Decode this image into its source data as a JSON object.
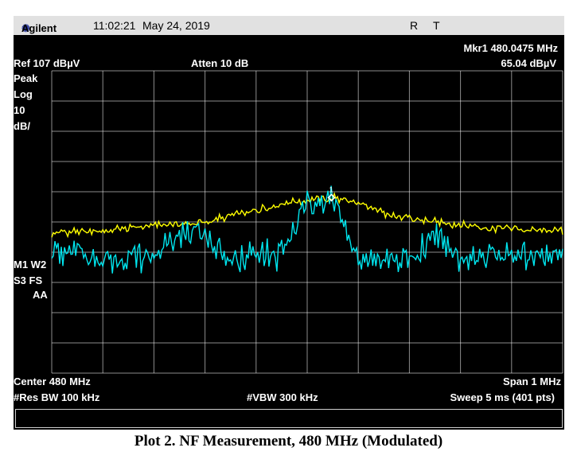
{
  "header": {
    "brand": "Agilent",
    "time": "11:02:21",
    "date": "May 24, 2019",
    "flag_r": "R",
    "flag_t": "T"
  },
  "marker": {
    "freq": "Mkr1  480.0475 MHz",
    "amp": "65.04 dBµV",
    "label": "1"
  },
  "settings": {
    "ref": "Ref 107 dBµV",
    "atten": "Atten 10 dB",
    "detector": "Peak",
    "scale_type": "Log",
    "scale_div": "10",
    "scale_unit": "dB/",
    "m1w2": "M1  W2",
    "s3fs": "S3  FS",
    "aa": "AA"
  },
  "footer": {
    "center": "Center 480 MHz",
    "span": "Span 1 MHz",
    "rbw": "#Res BW 100 kHz",
    "vbw": "#VBW 300 kHz",
    "sweep": "Sweep 5 ms (401 pts)"
  },
  "caption": "Plot 2. NF Measurement, 480 MHz (Modulated)",
  "colors": {
    "trace1": "#ffff00",
    "trace2": "#00e5ee",
    "grid": "#ffffff"
  },
  "chart_data": {
    "type": "line",
    "x_unit": "MHz",
    "y_unit": "dBµV",
    "xlim": [
      479.5,
      480.5
    ],
    "ylim": [
      7,
      107
    ],
    "y_per_div": 10,
    "grid": true,
    "x": [
      479.5,
      479.55,
      479.6,
      479.65,
      479.7,
      479.75,
      479.8,
      479.85,
      479.9,
      479.95,
      480.0,
      480.05,
      480.1,
      480.15,
      480.2,
      480.25,
      480.3,
      480.35,
      480.4,
      480.45,
      480.5
    ],
    "series": [
      {
        "trace": "yellow",
        "values": [
          53,
          54,
          54,
          55,
          56,
          56,
          57,
          59,
          61,
          63,
          64,
          65,
          63,
          60,
          58,
          57,
          56,
          55,
          55,
          54,
          54
        ]
      },
      {
        "trace": "cyan",
        "values": [
          46,
          46,
          44,
          45,
          45,
          54,
          53,
          44,
          46,
          46,
          63,
          64,
          45,
          45,
          44,
          53,
          45,
          45,
          46,
          45,
          46
        ]
      }
    ],
    "marker": {
      "x": 480.0475,
      "y": 65.04
    }
  }
}
